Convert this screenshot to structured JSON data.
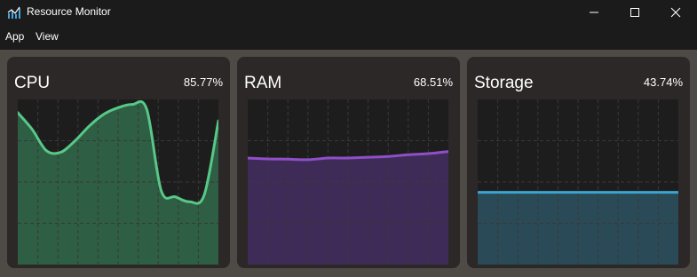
{
  "window": {
    "title": "Resource Monitor",
    "icon": "chart-app-icon",
    "controls": [
      "minimize-icon",
      "maximize-icon",
      "close-icon"
    ]
  },
  "menu": {
    "items": [
      {
        "label": "App"
      },
      {
        "label": "View"
      }
    ]
  },
  "colors": {
    "background": "#1c1b1b",
    "content_bg": "#4e4a45",
    "card_bg": "#2b2827",
    "plot_bg": "#1e1d1d",
    "cpu_line": "#57c888",
    "cpu_fill": "#2e5e43",
    "ram_line": "#8f4fc9",
    "ram_fill": "#3f2b57",
    "storage_line": "#3aa6cf",
    "storage_fill": "#2a4a57"
  },
  "cards": [
    {
      "title": "CPU",
      "percent": "85.77%"
    },
    {
      "title": "RAM",
      "percent": "68.51%"
    },
    {
      "title": "Storage",
      "percent": "43.74%"
    }
  ],
  "chart_data": [
    {
      "type": "area",
      "ylim": [
        0,
        100
      ],
      "grid": true,
      "values": [
        92,
        82,
        69,
        68,
        75,
        84,
        91,
        95,
        97,
        94,
        45,
        41,
        38,
        42,
        87
      ]
    },
    {
      "type": "area",
      "ylim": [
        0,
        100
      ],
      "grid": true,
      "values": [
        64.5,
        64,
        63.8,
        63.5,
        64.5,
        64.5,
        65,
        65.5,
        66.5,
        67.2,
        68.51
      ]
    },
    {
      "type": "area",
      "ylim": [
        0,
        100
      ],
      "grid": true,
      "values": [
        43.74,
        43.74
      ]
    }
  ]
}
